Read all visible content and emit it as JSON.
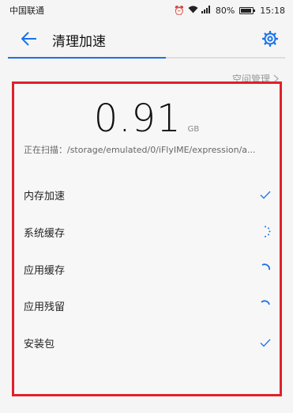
{
  "status_bar": {
    "carrier": "中国联通",
    "signal_label": "⁴ᴳ",
    "battery": "80%",
    "time": "15:18"
  },
  "header": {
    "title": "清理加速",
    "progress": 0.57
  },
  "space_link": "空间管理",
  "scan": {
    "size": "0.91",
    "unit": "GB",
    "status": "正在扫描：/storage/emulated/0/iFlyIME/expression/a..."
  },
  "items": [
    {
      "label": "内存加速",
      "state": "done"
    },
    {
      "label": "系统缓存",
      "state": "loading"
    },
    {
      "label": "应用缓存",
      "state": "loading"
    },
    {
      "label": "应用残留",
      "state": "loading"
    },
    {
      "label": "安装包",
      "state": "done"
    }
  ],
  "colors": {
    "accent": "#1a73e8",
    "highlight": "#e0202a"
  }
}
